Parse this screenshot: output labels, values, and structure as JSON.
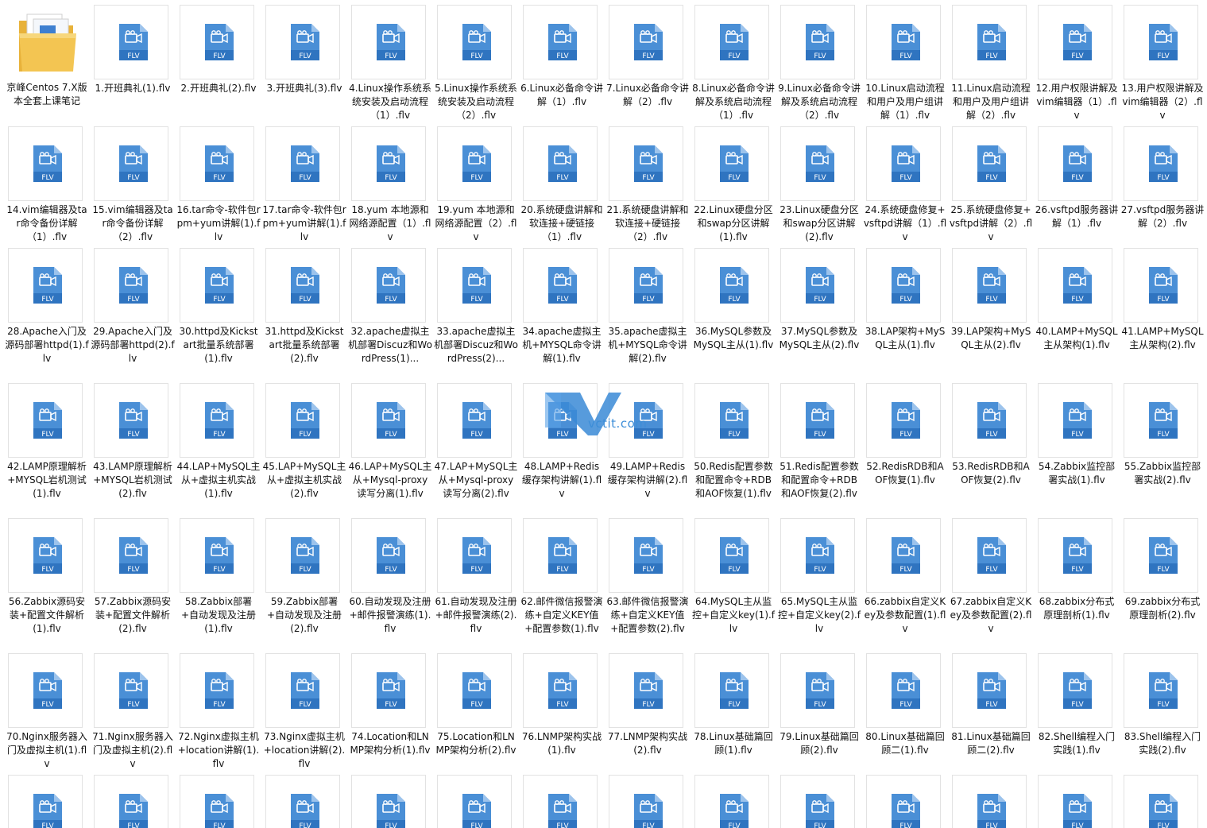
{
  "icon_label": "FLV",
  "folder": {
    "name": "京峰Centos 7.X版本全套上课笔记"
  },
  "files": [
    "1.开班典礼(1).flv",
    "2.开班典礼(2).flv",
    "3.开班典礼(3).flv",
    "4.Linux操作系统系统安装及启动流程（1）.flv",
    "5.Linux操作系统系统安装及启动流程（2）.flv",
    "6.Linux必备命令讲解（1）.flv",
    "7.Linux必备命令讲解（2）.flv",
    "8.Linux必备命令讲解及系统启动流程（1）.flv",
    "9.Linux必备命令讲解及系统启动流程（2）.flv",
    "10.Linux启动流程和用户及用户组讲解（1）.flv",
    "11.Linux启动流程和用户及用户组讲解（2）.flv",
    "12.用户权限讲解及vim编辑器（1）.flv",
    "13.用户权限讲解及vim编辑器（2）.flv",
    "14.vim编辑器及tar命令备份详解（1）.flv",
    "15.vim编辑器及tar命令备份详解（2）.flv",
    "16.tar命令-软件包rpm+yum讲解(1).flv",
    "17.tar命令-软件包rpm+yum讲解(1).flv",
    "18.yum 本地源和网络源配置（1）.flv",
    "19.yum 本地源和网络源配置（2）.flv",
    "20.系统硬盘讲解和软连接+硬链接（1）.flv",
    "21.系统硬盘讲解和软连接+硬链接（2）.flv",
    "22.Linux硬盘分区和swap分区讲解(1).flv",
    "23.Linux硬盘分区和swap分区讲解(2).flv",
    "24.系统硬盘修复+vsftpd讲解（1）.flv",
    "25.系统硬盘修复+vsftpd讲解（2）.flv",
    "26.vsftpd服务器讲解（1）.flv",
    "27.vsftpd服务器讲解（2）.flv",
    "28.Apache入门及源码部署httpd(1).flv",
    "29.Apache入门及源码部署httpd(2).flv",
    "30.httpd及Kickstart批量系统部署(1).flv",
    "31.httpd及Kickstart批量系统部署(2).flv",
    "32.apache虚拟主机部署Discuz和WordPress(1)...",
    "33.apache虚拟主机部署Discuz和WordPress(2)...",
    "34.apache虚拟主机+MYSQL命令讲解(1).flv",
    "35.apache虚拟主机+MYSQL命令讲解(2).flv",
    "36.MySQL参数及MySQL主从(1).flv",
    "37.MySQL参数及MySQL主从(2).flv",
    "38.LAP架构+MySQL主从(1).flv",
    "39.LAP架构+MySQL主从(2).flv",
    "40.LAMP+MySQL主从架构(1).flv",
    "41.LAMP+MySQL主从架构(2).flv",
    "42.LAMP原理解析+MYSQL岩机测试(1).flv",
    "43.LAMP原理解析+MYSQL岩机测试(2).flv",
    "44.LAP+MySQL主从+虚拟主机实战(1).flv",
    "45.LAP+MySQL主从+虚拟主机实战(2).flv",
    "46.LAP+MySQL主从+Mysql-proxy读写分离(1).flv",
    "47.LAP+MySQL主从+Mysql-proxy读写分离(2).flv",
    "48.LAMP+Redis缓存架构讲解(1).flv",
    "49.LAMP+Redis缓存架构讲解(2).flv",
    "50.Redis配置参数和配置命令+RDB和AOF恢复(1).flv",
    "51.Redis配置参数和配置命令+RDB和AOF恢复(2).flv",
    "52.RedisRDB和AOF恢复(1).flv",
    "53.RedisRDB和AOF恢复(2).flv",
    "54.Zabbix监控部署实战(1).flv",
    "55.Zabbix监控部署实战(2).flv",
    "56.Zabbix源码安装+配置文件解析(1).flv",
    "57.Zabbix源码安装+配置文件解析(2).flv",
    "58.Zabbix部署+自动发现及注册(1).flv",
    "59.Zabbix部署+自动发现及注册(2).flv",
    "60.自动发现及注册+邮件报警演练(1).flv",
    "61.自动发现及注册+邮件报警演练(2).flv",
    "62.邮件微信报警演练+自定义KEY值+配置参数(1).flv",
    "63.邮件微信报警演练+自定义KEY值+配置参数(2).flv",
    "64.MySQL主从监控+自定义key(1).flv",
    "65.MySQL主从监控+自定义key(2).flv",
    "66.zabbix自定义Key及参数配置(1).flv",
    "67.zabbix自定义Key及参数配置(2).flv",
    "68.zabbix分布式原理剖析(1).flv",
    "69.zabbix分布式原理剖析(2).flv",
    "70.Nginx服务器入门及虚拟主机(1).flv",
    "71.Nginx服务器入门及虚拟主机(2).flv",
    "72.Nginx虚拟主机+location讲解(1).flv",
    "73.Nginx虚拟主机+location讲解(2).flv",
    "74.Location和LNMP架构分析(1).flv",
    "75.Location和LNMP架构分析(2).flv",
    "76.LNMP架构实战(1).flv",
    "77.LNMP架构实战(2).flv",
    "78.Linux基础篇回顾(1).flv",
    "79.Linux基础篇回顾(2).flv",
    "80.Linux基础篇回顾二(1).flv",
    "81.Linux基础篇回顾二(2).flv",
    "82.Shell编程入门实践(1).flv",
    "83.Shell编程入门实践(2).flv"
  ],
  "partial_row_count": 14,
  "watermark": {
    "text": "vctit.com"
  },
  "colors": {
    "icon_blue": "#4a8fd6",
    "icon_band": "#2f74c0",
    "tile_border": "#e2e2e2",
    "folder_yellow": "#f3c552"
  }
}
